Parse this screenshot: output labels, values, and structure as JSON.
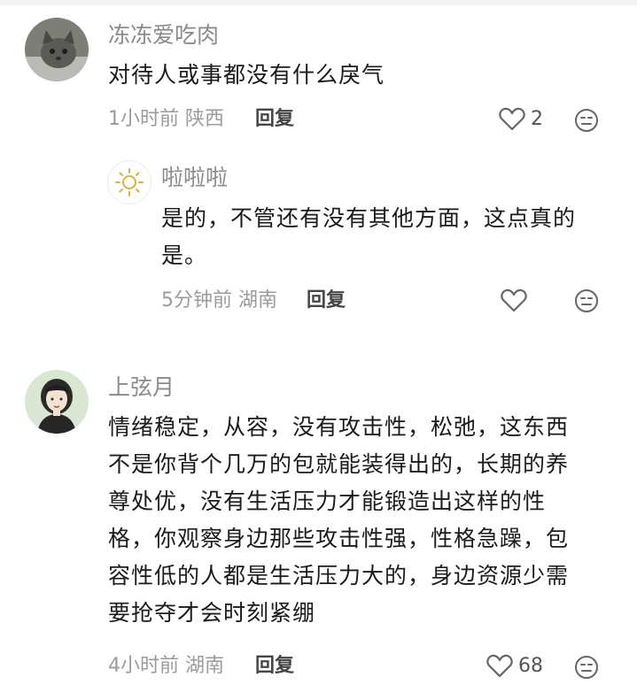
{
  "comments": [
    {
      "user": "冻冻爱吃肉",
      "text": "对待人或事都没有什么戾气",
      "time": "1小时前",
      "location": "陕西",
      "reply_label": "回复",
      "likes": "2",
      "reply": {
        "user": "啦啦啦",
        "text_line1": "是的，不管还有没有其他方面，这点真的",
        "text_line2": "是。",
        "time": "5分钟前",
        "location": "湖南",
        "reply_label": "回复"
      }
    },
    {
      "user": "上弦月",
      "text_lines": [
        "情绪稳定，从容，没有攻击性，松弛，这东西",
        "不是你背个几万的包就能装得出的，长期的养",
        "尊处优，没有生活压力才能锻造出这样的性",
        "格，你观察身边那些攻击性强，性格急躁，包",
        "容性低的人都是生活压力大的，身边资源少需",
        "要抢夺才会时刻紧绷"
      ],
      "time": "4小时前",
      "location": "湖南",
      "reply_label": "回复",
      "likes": "68"
    }
  ],
  "icons": {
    "like": "heart-outline-icon",
    "more": "smiley-face-icon",
    "avatar_reply": "sun-icon"
  },
  "colors": {
    "name": "#8b8b8b",
    "meta": "#9b9b9b",
    "text": "#1b1b1b"
  }
}
